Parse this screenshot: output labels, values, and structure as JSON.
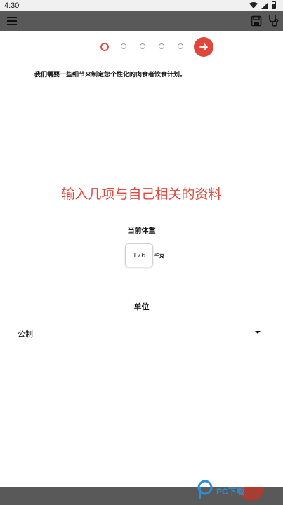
{
  "status_bar": {
    "time": "4:30",
    "icons": [
      "wifi-icon",
      "signal-icon",
      "battery-icon"
    ]
  },
  "toolbar": {
    "icons": [
      "menu-icon",
      "save-icon",
      "stethoscope-icon"
    ],
    "color": "#595959"
  },
  "stepper": {
    "current_step": 1,
    "total_steps": 5,
    "next_icon": "arrow-right-icon",
    "accent_color": "#e0473a"
  },
  "intro": {
    "text": "我们需要一些细节来制定您个性化的肉食者饮食计划。"
  },
  "headline": {
    "text": "输入几项与自己相关的资料"
  },
  "weight": {
    "label": "当前体重",
    "value": "176",
    "unit": "千克"
  },
  "units": {
    "label": "单位",
    "selected": "公制"
  },
  "watermark": {
    "text": "PC下载"
  }
}
